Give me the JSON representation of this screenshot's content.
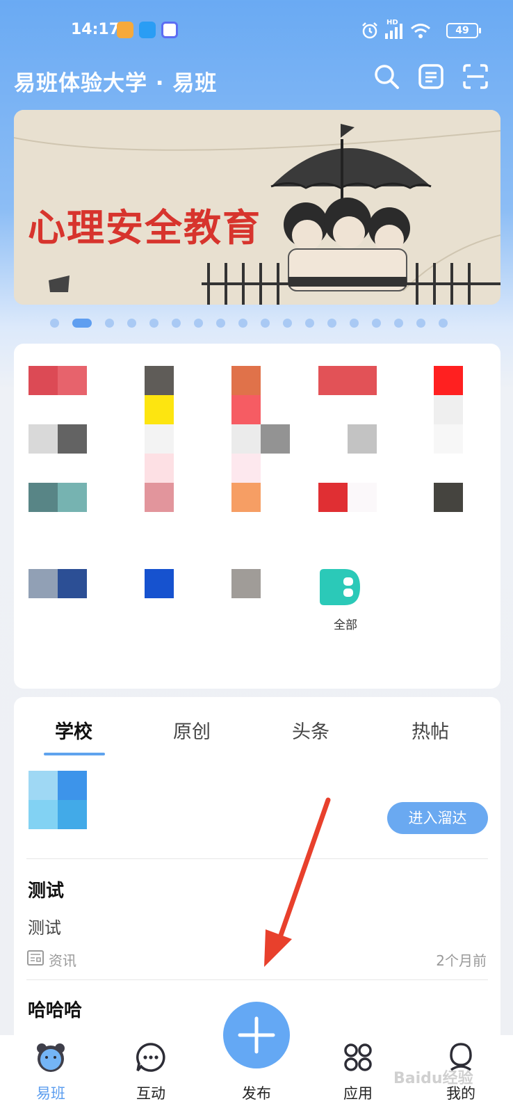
{
  "status_bar": {
    "time": "14:17",
    "battery": "49",
    "network": "HD"
  },
  "header": {
    "title": "易班体验大学 · 易班",
    "icons": [
      "search-icon",
      "sign-in-icon",
      "scan-icon"
    ]
  },
  "banner": {
    "text": "心理安全教育",
    "dot_count": 18,
    "active_dot": 1
  },
  "grid": {
    "all_label": "全部"
  },
  "feed": {
    "tabs": [
      "学校",
      "原创",
      "头条",
      "热帖"
    ],
    "active_tab": 0,
    "enter_button": "进入溜达",
    "posts": [
      {
        "title": "测试",
        "body": "测试",
        "category": "资讯",
        "time": "2个月前"
      },
      {
        "title": "哈哈哈"
      }
    ]
  },
  "bottom_nav": {
    "items": [
      "易班",
      "互动",
      "发布",
      "应用",
      "我的"
    ],
    "active": 0
  },
  "watermark": "Baidu经验",
  "colors": {
    "accent": "#64a8f4",
    "header_bg": "#6aaaf3",
    "arrow": "#e8402c"
  }
}
